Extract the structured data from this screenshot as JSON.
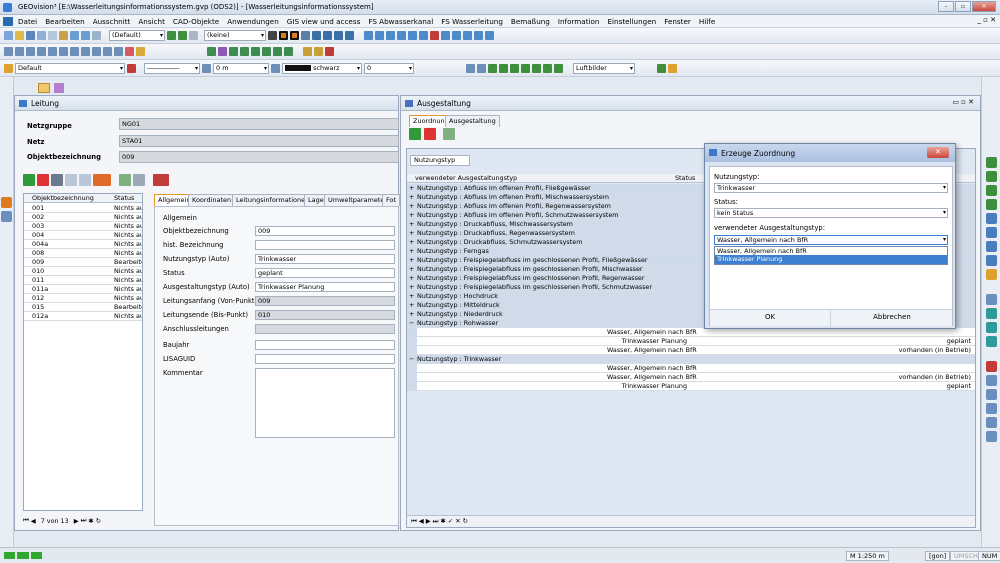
{
  "window": {
    "title": "GEOvision³ [E:\\Wasserleitungsinformationssystem.gvp (ODS2)] - [Wasserleitungsinformationssystem]"
  },
  "menu": [
    "Datei",
    "Bearbeiten",
    "Ausschnitt",
    "Ansicht",
    "CAD-Objekte",
    "Anwendungen",
    "GIS view und access",
    "FS Abwasserkanal",
    "FS Wasserleitung",
    "Bemaßung",
    "Information",
    "Einstellungen",
    "Fenster",
    "Hilfe"
  ],
  "toolbar": {
    "style_select": "(Default)",
    "filter_select": "(keine)",
    "layer_select": "Default",
    "offset": "0 m",
    "color_label": "schwarz",
    "number": "0",
    "background_select": "Luftbilder"
  },
  "leitung": {
    "title": "Leitung",
    "netzgruppe_label": "Netzgruppe",
    "netzgruppe_value": "NG01",
    "netz_label": "Netz",
    "netz_value": "STA01",
    "objekt_label": "Objektbezeichnung",
    "objekt_value": "009",
    "list_headers": [
      "Objektbezeichnung",
      "Status"
    ],
    "rows": [
      [
        "001",
        "Nichts aus"
      ],
      [
        "002",
        "Nichts aus"
      ],
      [
        "003",
        "Nichts aus"
      ],
      [
        "004",
        "Nichts aus"
      ],
      [
        "004a",
        "Nichts aus"
      ],
      [
        "008",
        "Nichts aus"
      ],
      [
        "009",
        "Bearbeite"
      ],
      [
        "010",
        "Nichts aus"
      ],
      [
        "011",
        "Nichts aus"
      ],
      [
        "011a",
        "Nichts aus"
      ],
      [
        "012",
        "Nichts aus"
      ],
      [
        "015",
        "Bearbeite"
      ],
      [
        "012a",
        "Nichts aus"
      ]
    ],
    "nav_text": "7 von 13",
    "tabs": [
      "Allgemein",
      "Koordinaten",
      "Leitungsinformationen",
      "Lage",
      "Umweltparameter",
      "Fot"
    ],
    "group_label": "Allgemein",
    "fields": [
      {
        "label": "Objektbezeichnung",
        "value": "009",
        "gray": false
      },
      {
        "label": "hist. Bezeichnung",
        "value": "",
        "gray": false
      },
      {
        "label": "Nutzungstyp (Auto)",
        "value": "Trinkwasser",
        "gray": false
      },
      {
        "label": "Status",
        "value": "geplant",
        "gray": false
      },
      {
        "label": "Ausgestaltungstyp (Auto)",
        "value": "Trinkwasser Planung",
        "gray": false
      },
      {
        "label": "Leitungsanfang (Von-Punkt)",
        "value": "009",
        "gray": true
      },
      {
        "label": "Leitungsende (Bis-Punkt)",
        "value": "010",
        "gray": true
      },
      {
        "label": "Anschlussleitungen",
        "value": "",
        "gray": true
      },
      {
        "label": "Baujahr",
        "value": "",
        "gray": false
      },
      {
        "label": "LISAGUID",
        "value": "",
        "gray": false
      },
      {
        "label": "Kommentar",
        "value": "",
        "gray": false
      }
    ]
  },
  "ausgestaltung": {
    "title": "Ausgestaltung",
    "tabs": [
      "Zuordnung",
      "Ausgestaltung"
    ],
    "group_chip": "Nutzungstyp",
    "col_headers": [
      "verwendeter Ausgestaltungstyp",
      "Status"
    ],
    "rows": [
      "Nutzungstyp : Abfluss im offenen Profil, Fließgewässer",
      "Nutzungstyp : Abfluss im offenen Profil, Mischwassersystem",
      "Nutzungstyp : Abfluss im offenen Profil, Regenwassersystem",
      "Nutzungstyp : Abfluss im offenen Profil, Schmutzwassersystem",
      "Nutzungstyp : Druckabfluss, Mischwassersystem",
      "Nutzungstyp : Druckabfluss, Regenwassersystem",
      "Nutzungstyp : Druckabfluss, Schmutzwassersystem",
      "Nutzungstyp : Ferngas",
      "Nutzungstyp : Freispiegelabfluss im geschlossenen Profil, Fließgewässer",
      "Nutzungstyp : Freispiegelabfluss im geschlossenen Profil, Mischwasser",
      "Nutzungstyp : Freispiegelabfluss im geschlossenen Profil, Regenwasser",
      "Nutzungstyp : Freispiegelabfluss im geschlossenen Profil, Schmutzwasser",
      "Nutzungstyp : Hochdruck",
      "Nutzungstyp : Mitteldruck",
      "Nutzungstyp : Niederdruck",
      "Nutzungstyp : Rohwasser"
    ],
    "rohwasser_children": [
      [
        "Wasser, Allgemein nach BfR",
        ""
      ],
      [
        "Trinkwasser Planung",
        "geplant"
      ],
      [
        "Wasser, Allgemein nach BfR",
        "vorhanden (in Betrieb)"
      ]
    ],
    "trink_header": "Nutzungstyp : Trinkwasser",
    "trink_children": [
      [
        "Wasser, Allgemein nach BfR",
        ""
      ],
      [
        "Wasser, Allgemein nach BfR",
        "vorhanden (in Betrieb)"
      ],
      [
        "Trinkwasser Planung",
        "geplant"
      ]
    ]
  },
  "dialog": {
    "title": "Erzeuge Zuordnung",
    "nutzungstyp_label": "Nutzungstyp:",
    "nutzungstyp_value": "Trinkwasser",
    "status_label": "Status:",
    "status_value": "kein Status",
    "ausgestaltung_label": "verwendeter Ausgestaltungstyp:",
    "ausgestaltung_value": "Wasser, Allgemein nach BfR",
    "options": [
      "Wasser, Allgemein nach BfR",
      "Trinkwasser Planung"
    ],
    "ok": "OK",
    "cancel": "Abbrechen"
  },
  "status": {
    "scale": "M 1:250 m",
    "angle": "[gon]",
    "umsch": "UMSCH",
    "num": "NUM"
  }
}
